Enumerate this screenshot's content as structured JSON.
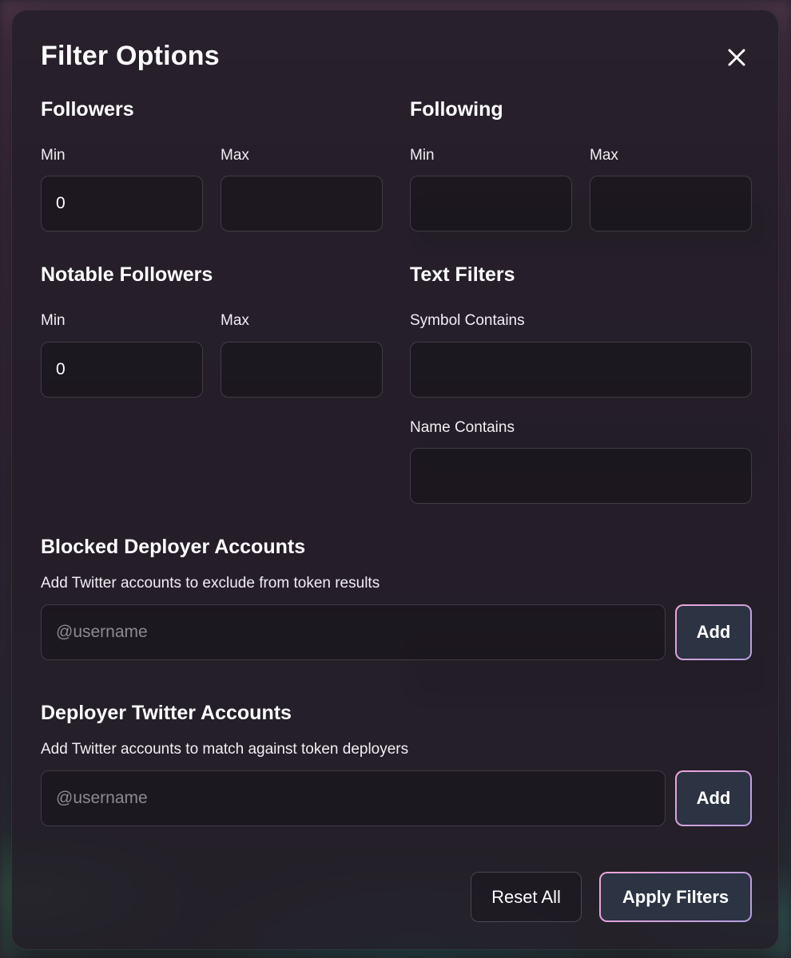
{
  "modal": {
    "title": "Filter Options"
  },
  "followers": {
    "title": "Followers",
    "min_label": "Min",
    "max_label": "Max",
    "min_value": "0",
    "max_value": ""
  },
  "following": {
    "title": "Following",
    "min_label": "Min",
    "max_label": "Max",
    "min_value": "",
    "max_value": ""
  },
  "notable_followers": {
    "title": "Notable Followers",
    "min_label": "Min",
    "max_label": "Max",
    "min_value": "0",
    "max_value": ""
  },
  "text_filters": {
    "title": "Text Filters",
    "symbol_label": "Symbol Contains",
    "symbol_value": "",
    "name_label": "Name Contains",
    "name_value": ""
  },
  "blocked_deployers": {
    "title": "Blocked Deployer Accounts",
    "description": "Add Twitter accounts to exclude from token results",
    "placeholder": "@username",
    "add_label": "Add"
  },
  "deployer_twitter": {
    "title": "Deployer Twitter Accounts",
    "description": "Add Twitter accounts to match against token deployers",
    "placeholder": "@username",
    "add_label": "Add"
  },
  "footer": {
    "reset_label": "Reset All",
    "apply_label": "Apply Filters"
  },
  "icons": {
    "close": "close-icon"
  },
  "colors": {
    "accent_gradient_start": "#f0a6d8",
    "accent_gradient_end": "#b39de0",
    "button_bg": "#2c3342"
  }
}
